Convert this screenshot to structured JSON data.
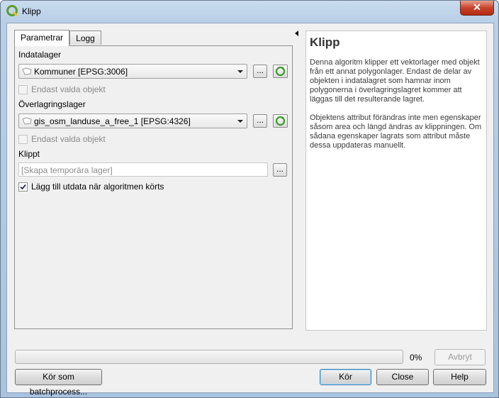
{
  "window": {
    "title": "Klipp",
    "close_symbol": "✕"
  },
  "tabs": [
    {
      "label": "Parametrar",
      "active": true
    },
    {
      "label": "Logg",
      "active": false
    }
  ],
  "params": {
    "input_layer": {
      "label": "Indatalager",
      "value": "Kommuner [EPSG:3006]",
      "selected_only_label": "Endast valda objekt",
      "selected_only_checked": false
    },
    "overlay_layer": {
      "label": "Överlagringslager",
      "value": "gis_osm_landuse_a_free_1 [EPSG:4326]",
      "selected_only_label": "Endast valda objekt",
      "selected_only_checked": false
    },
    "output": {
      "label": "Klippt",
      "placeholder": "[Skapa temporära lager]",
      "browse_label": "...",
      "open_output_label": "Lägg till utdata när algoritmen körts",
      "open_output_checked": true
    },
    "browse_label": "..."
  },
  "help": {
    "title": "Klipp",
    "paragraphs": [
      "Denna algoritm klipper ett vektorlager med objekt från ett annat polygonlager. Endast de delar av objekten i indatalagret som hamnar inom polygonerna i överlagringslagret kommer att läggas till det resulterande lagret.",
      "Objektens attribut förändras inte men egenskaper såsom area och längd ändras av klippningen. Om sådana egenskaper lagrats som attribut måste dessa uppdateras manuellt."
    ]
  },
  "progress": {
    "value": 0,
    "label": "0%"
  },
  "buttons": {
    "cancel": "Avbryt",
    "batch": "Kör som batchprocess...",
    "run": "Kör",
    "close": "Close",
    "help": "Help"
  },
  "colors": {
    "qgis_green": "#5b9e2f",
    "progress_green": "#06b025",
    "iterate_green": "#3a9c2a"
  }
}
